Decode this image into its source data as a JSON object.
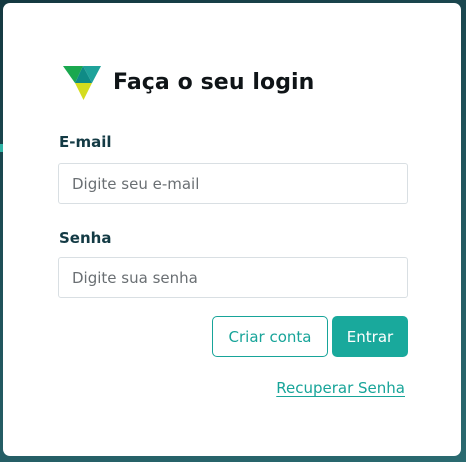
{
  "colors": {
    "accent": "#19a99c",
    "label_text": "#133a44",
    "backdrop": "#1f4a52",
    "logo_green": "#1aa84f",
    "logo_teal": "#1ea29a",
    "logo_yellow": "#d4dc1f"
  },
  "header": {
    "logo_icon": "triangle-logo-icon",
    "title": "Faça o seu login"
  },
  "form": {
    "email": {
      "label": "E-mail",
      "placeholder": "Digite seu e-mail",
      "value": ""
    },
    "password": {
      "label": "Senha",
      "placeholder": "Digite sua senha",
      "value": ""
    }
  },
  "actions": {
    "create_account": "Criar conta",
    "login": "Entrar",
    "recover_password": "Recuperar Senha"
  }
}
